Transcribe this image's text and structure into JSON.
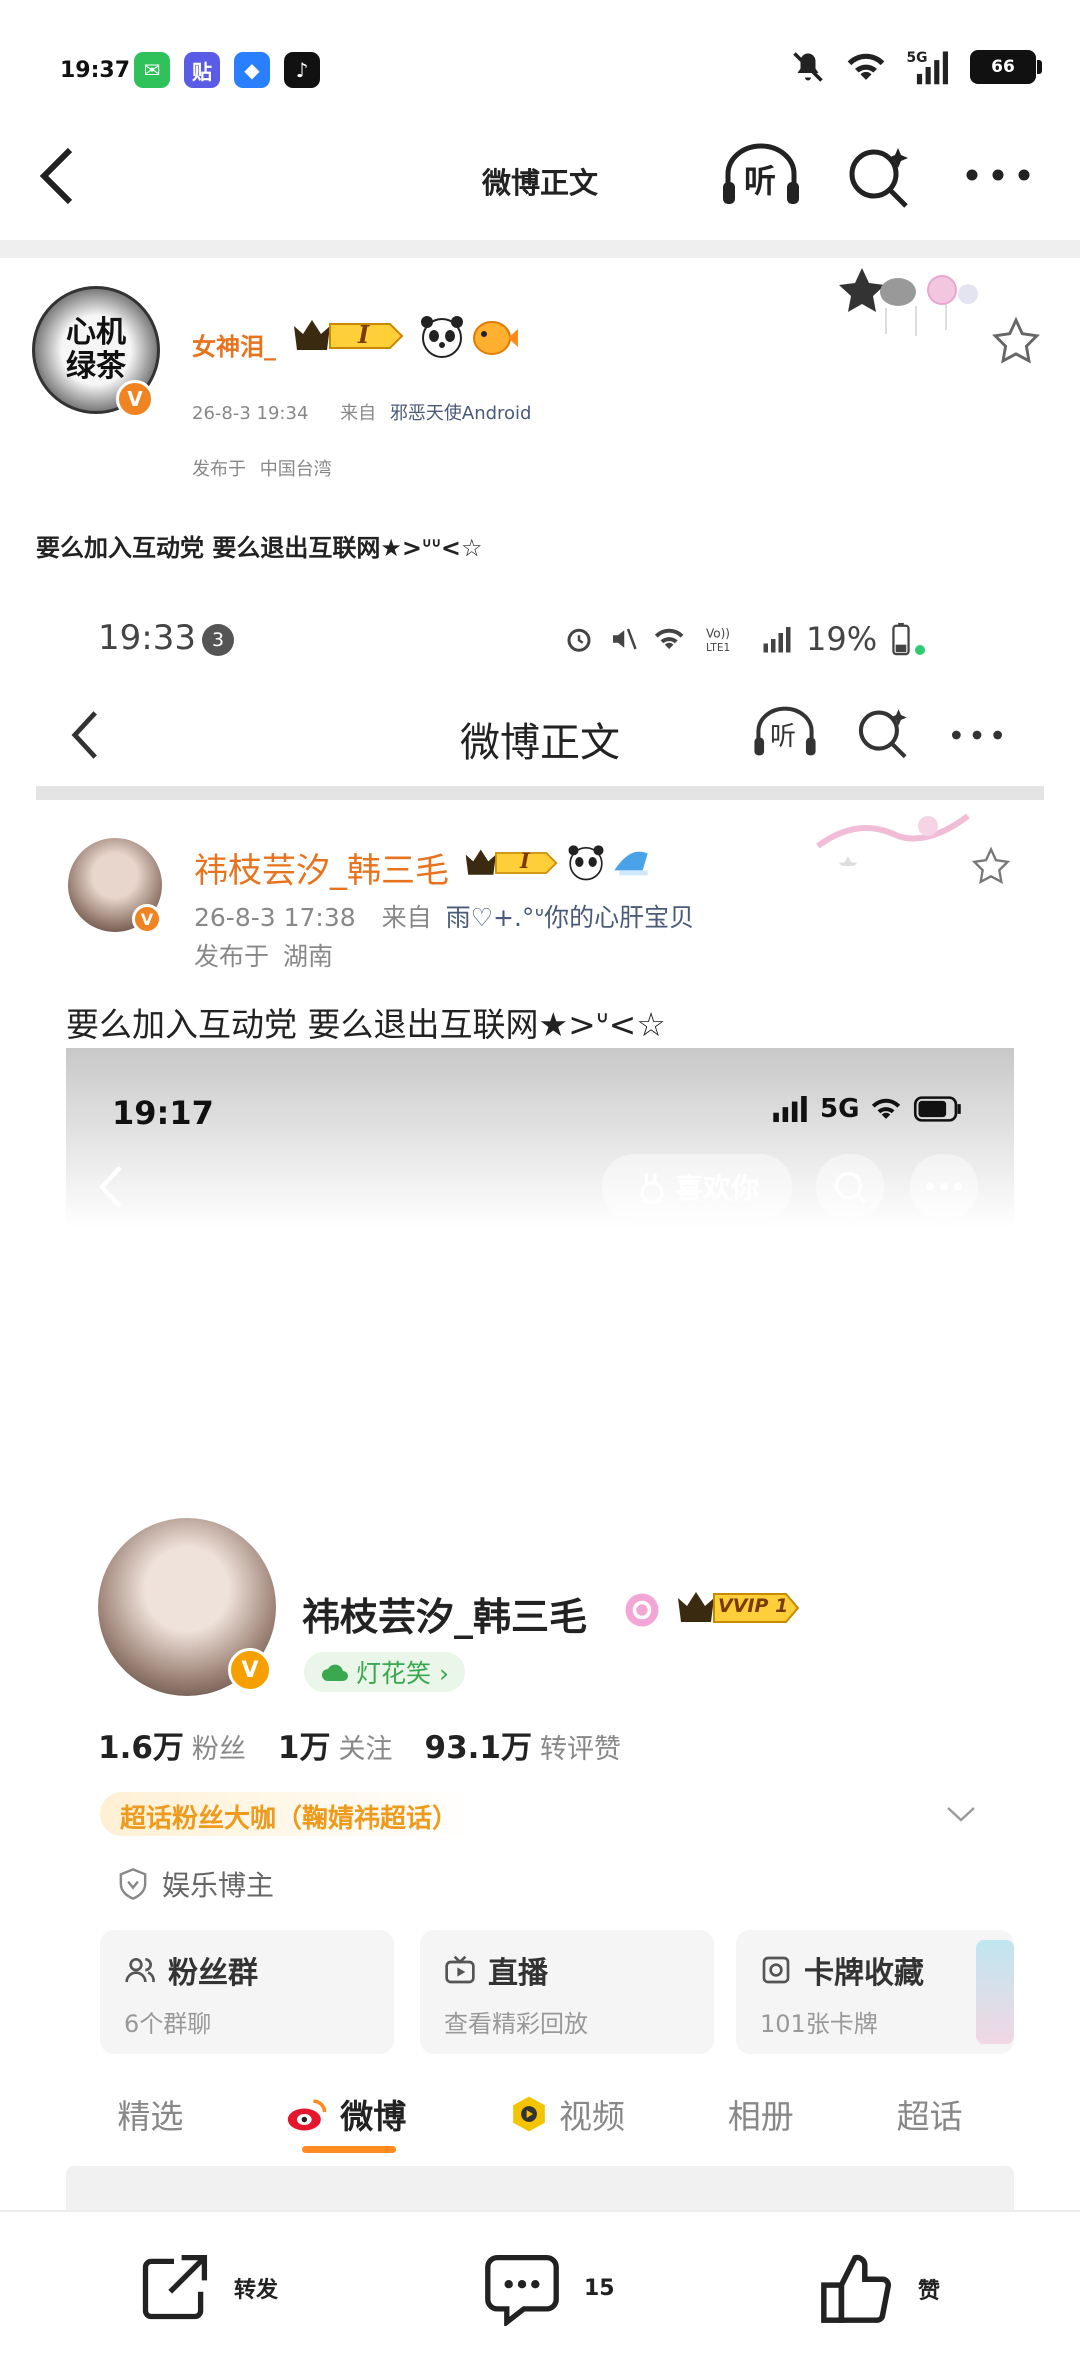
{
  "status_bar": {
    "time": "19:37",
    "apps": [
      "wechat-icon",
      "tieba-icon",
      "feishu-icon",
      "tiktok-icon"
    ],
    "battery": "66"
  },
  "header": {
    "title": "微博正文",
    "listen_label": "听"
  },
  "post": {
    "avatar_text": "心机绿茶",
    "verified_label": "V",
    "username": "女神泪_",
    "level_badge": "I",
    "date": "26-8-3 19:34",
    "source_prefix": "来自",
    "source": "邪恶天使Android",
    "location_prefix": "发布于",
    "location": "中国台湾",
    "text": "要么加入互动党 要么退出互联网★>ᐡᐡ<☆"
  },
  "inner_post": {
    "status_time": "19:33",
    "notif_count": "3",
    "battery_pct": "19%",
    "title": "微博正文",
    "listen_label": "听",
    "username": "祎枝芸汐_韩三毛",
    "level_badge": "I",
    "date": "26-8-3 17:38",
    "source_prefix": "来自",
    "source": "雨♡+.°ᐡ你的心肝宝贝",
    "location_prefix": "发布于",
    "location": "湖南",
    "text": "要么加入互动党 要么退出互联网★>ᐡ<☆"
  },
  "profile": {
    "status_time": "19:17",
    "network": "5G",
    "like_button": "喜欢你",
    "name": "祎枝芸汐_韩三毛",
    "vip_badge": "VVIP 1",
    "tag": "灯花笑 ›",
    "stats": [
      {
        "value": "1.6万",
        "label": "粉丝"
      },
      {
        "value": "1万",
        "label": "关注"
      },
      {
        "value": "93.1万",
        "label": "转评赞"
      }
    ],
    "super_fan": "超话粉丝大咖（鞠婧祎超话）",
    "category": "娱乐博主",
    "cards": [
      {
        "title": "粉丝群",
        "sub": "6个群聊",
        "icon": "group-icon"
      },
      {
        "title": "直播",
        "sub": "查看精彩回放",
        "icon": "tv-icon"
      },
      {
        "title": "卡牌收藏",
        "sub": "101张卡牌",
        "icon": "card-icon"
      }
    ],
    "tabs": [
      "精选",
      "微博",
      "视频",
      "相册",
      "超话"
    ],
    "active_tab": "微博"
  },
  "bottom_bar": {
    "repost": "转发",
    "comments": "15",
    "like": "赞"
  },
  "colors": {
    "accent_orange": "#e8731e",
    "verified_orange": "#f08422",
    "tab_underline": "#ff8a1f",
    "tag_green": "#3aa84e"
  }
}
